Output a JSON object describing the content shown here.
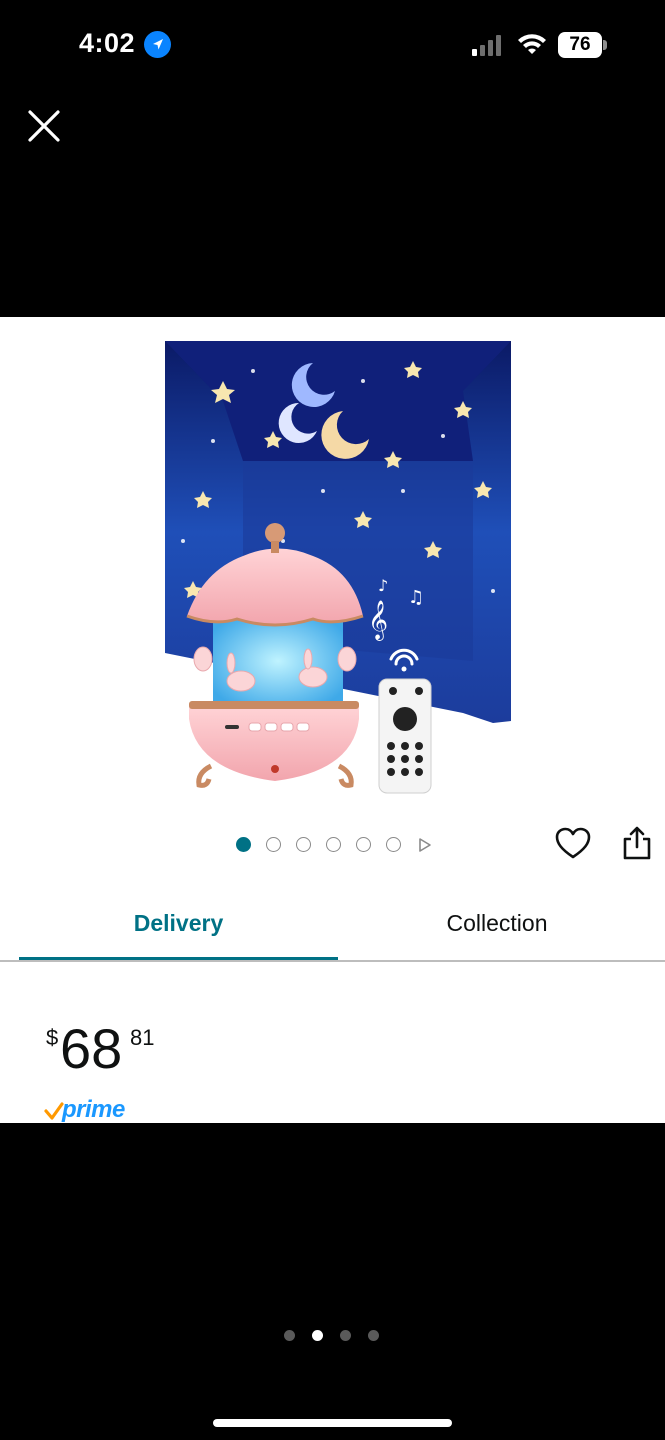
{
  "status_bar": {
    "time": "4:02",
    "battery": "76",
    "icons": [
      "location-arrow-icon",
      "signal-icon",
      "wifi-icon",
      "battery-icon"
    ]
  },
  "top_bar": {
    "close_icon": "close-icon"
  },
  "product": {
    "image_icon": "star-projector-night-light-image",
    "carousel": {
      "total": 6,
      "active_index": 0,
      "has_video": true
    },
    "actions": {
      "wishlist_icon": "heart-icon",
      "share_icon": "share-icon"
    }
  },
  "tabs": [
    {
      "label": "Delivery",
      "selected": true
    },
    {
      "label": "Collection",
      "selected": false
    }
  ],
  "price": {
    "currency": "$",
    "whole": "68",
    "fraction": "81"
  },
  "prime": {
    "label": "prime"
  },
  "page_indicator": {
    "total": 4,
    "active_index": 1
  },
  "colors": {
    "accent": "#007185",
    "prime_blue": "#1a98ff",
    "prime_check": "#f90"
  }
}
